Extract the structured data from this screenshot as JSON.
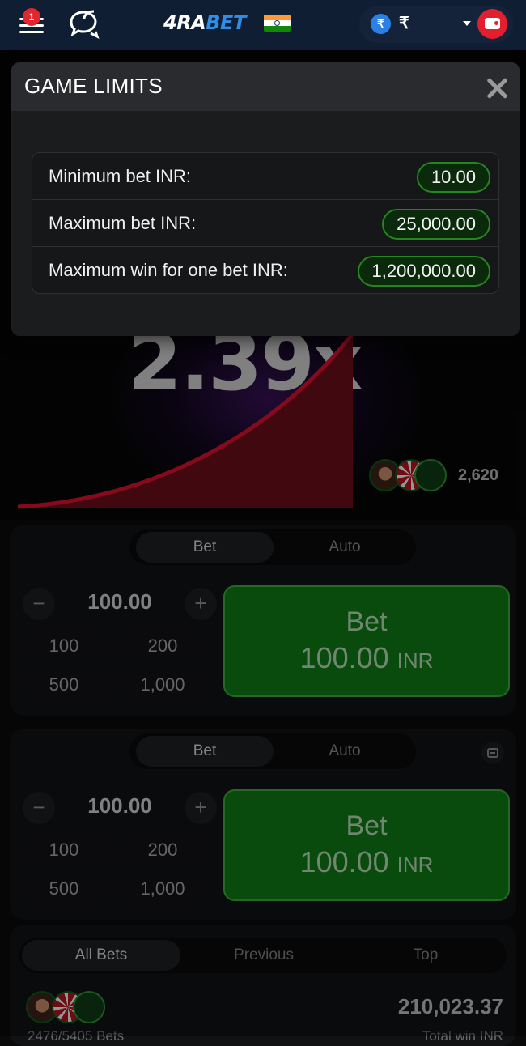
{
  "header": {
    "notification_count": "1",
    "logo_text": "4RABET",
    "currency_symbol": "₹",
    "currency_coin": "₹"
  },
  "game": {
    "multiplier": "2.39x",
    "players_count": "2,620"
  },
  "bet_panels": [
    {
      "tab_active": "Bet",
      "tab_inactive": "Auto",
      "minus": "−",
      "plus": "+",
      "amount": "100.00",
      "quick": [
        "100",
        "200",
        "500",
        "1,000"
      ],
      "button_label": "Bet",
      "button_amount": "100.00",
      "button_currency": "INR"
    },
    {
      "tab_active": "Bet",
      "tab_inactive": "Auto",
      "minus": "−",
      "plus": "+",
      "amount": "100.00",
      "quick": [
        "100",
        "200",
        "500",
        "1,000"
      ],
      "button_label": "Bet",
      "button_amount": "100.00",
      "button_currency": "INR"
    }
  ],
  "bets_list": {
    "tabs": [
      "All Bets",
      "Previous",
      "Top"
    ],
    "total": "210,023.37",
    "bets_count": "2476/5405 Bets",
    "total_label": "Total win INR"
  },
  "modal": {
    "title": "GAME LIMITS",
    "rows": [
      {
        "label": "Minimum bet INR:",
        "value": "10.00"
      },
      {
        "label": "Maximum bet INR:",
        "value": "25,000.00"
      },
      {
        "label": "Maximum win for one bet INR:",
        "value": "1,200,000.00"
      }
    ]
  },
  "colors": {
    "header_bg": "#0f1e33",
    "accent_red": "#e31e2e",
    "bet_green": "#0f7a14",
    "limit_border_green": "#25861f"
  }
}
